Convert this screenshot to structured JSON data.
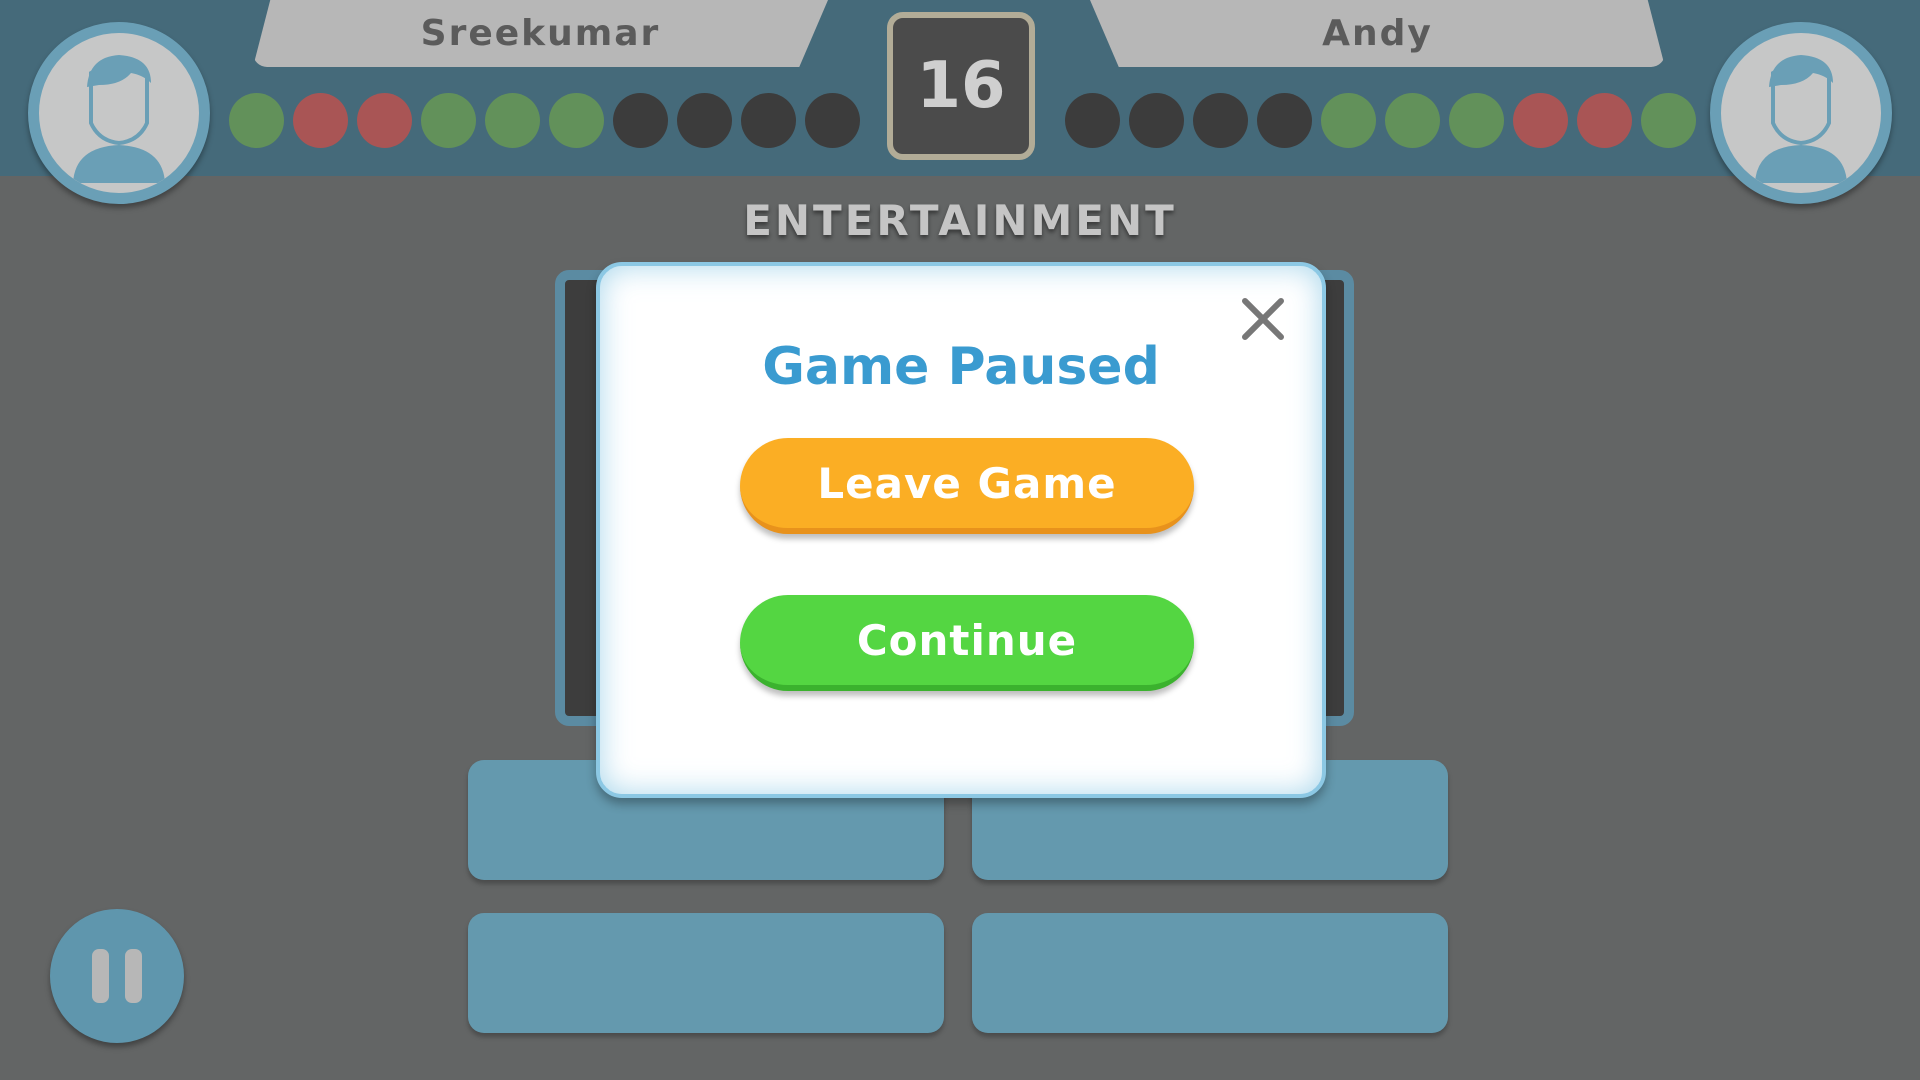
{
  "players": {
    "left": {
      "name": "Sreekumar",
      "results": [
        "correct",
        "wrong",
        "wrong",
        "correct",
        "correct",
        "correct",
        "pending",
        "pending",
        "pending",
        "pending"
      ]
    },
    "right": {
      "name": "Andy",
      "results": [
        "pending",
        "pending",
        "pending",
        "pending",
        "correct",
        "correct",
        "correct",
        "wrong",
        "wrong",
        "correct"
      ]
    }
  },
  "timer": {
    "value": "16"
  },
  "category": {
    "label": "ENTERTAINMENT"
  },
  "modal": {
    "title": "Game Paused",
    "leave_label": "Leave Game",
    "continue_label": "Continue",
    "close_icon": "close-icon"
  },
  "answers": {
    "count_visible": 4
  },
  "pause": {
    "icon": "pause-icon"
  },
  "colors": {
    "correct": "#62915a",
    "wrong": "#a95555",
    "pending": "#3c3c3c",
    "title": "#3a9bd0",
    "leave": "#fbae24",
    "continue": "#54d642",
    "topbar": "#456a7a",
    "answer": "#6499ae"
  }
}
